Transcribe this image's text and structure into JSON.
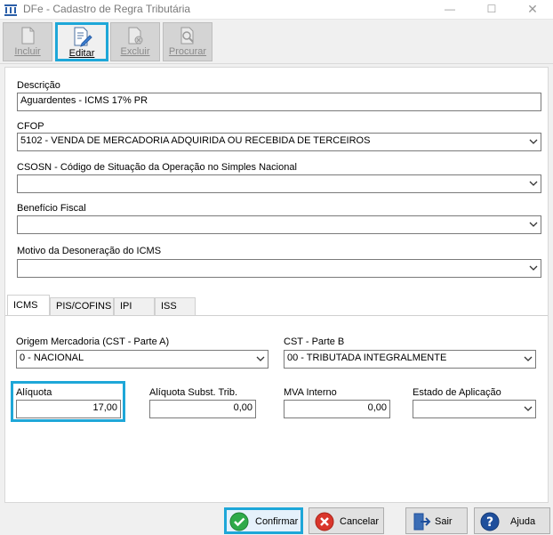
{
  "window": {
    "title": "DFe - Cadastro de Regra Tributária",
    "minimize": "—",
    "maximize": "☐",
    "close": "✕"
  },
  "toolbar": {
    "incluir": "Incluir",
    "editar": "Editar",
    "excluir": "Excluir",
    "procurar": "Procurar"
  },
  "form": {
    "descricao_label": "Descrição",
    "descricao_value": "Aguardentes -  ICMS 17% PR",
    "cfop_label": "CFOP",
    "cfop_value": "5102 - VENDA DE MERCADORIA ADQUIRIDA OU RECEBIDA DE TERCEIROS",
    "csosn_label": "CSOSN - Código de Situação da Operação no Simples Nacional",
    "csosn_value": "",
    "beneficio_label": "Benefício Fiscal",
    "beneficio_value": "",
    "motivo_label": "Motivo da Desoneração do ICMS",
    "motivo_value": ""
  },
  "tabs": [
    "ICMS",
    "PIS/COFINS",
    "IPI",
    "ISS"
  ],
  "icms": {
    "origem_label": "Origem Mercadoria (CST - Parte A)",
    "origem_value": "0 - NACIONAL",
    "cst_label": "CST - Parte B",
    "cst_value": "00 - TRIBUTADA INTEGRALMENTE",
    "aliquota_label": "Alíquota",
    "aliquota_value": "17,00",
    "aliquota_st_label": "Alíquota Subst. Trib.",
    "aliquota_st_value": "0,00",
    "mva_label": "MVA Interno",
    "mva_value": "0,00",
    "estado_label": "Estado de Aplicação",
    "estado_value": ""
  },
  "buttons": {
    "confirmar": "Confirmar",
    "cancelar": "Cancelar",
    "sair": "Sair",
    "ajuda": "Ajuda"
  },
  "colors": {
    "highlight": "#1ea7d8",
    "confirm_green": "#2eaa4a",
    "cancel_red": "#d9362b",
    "help_blue": "#1f4f9c"
  }
}
